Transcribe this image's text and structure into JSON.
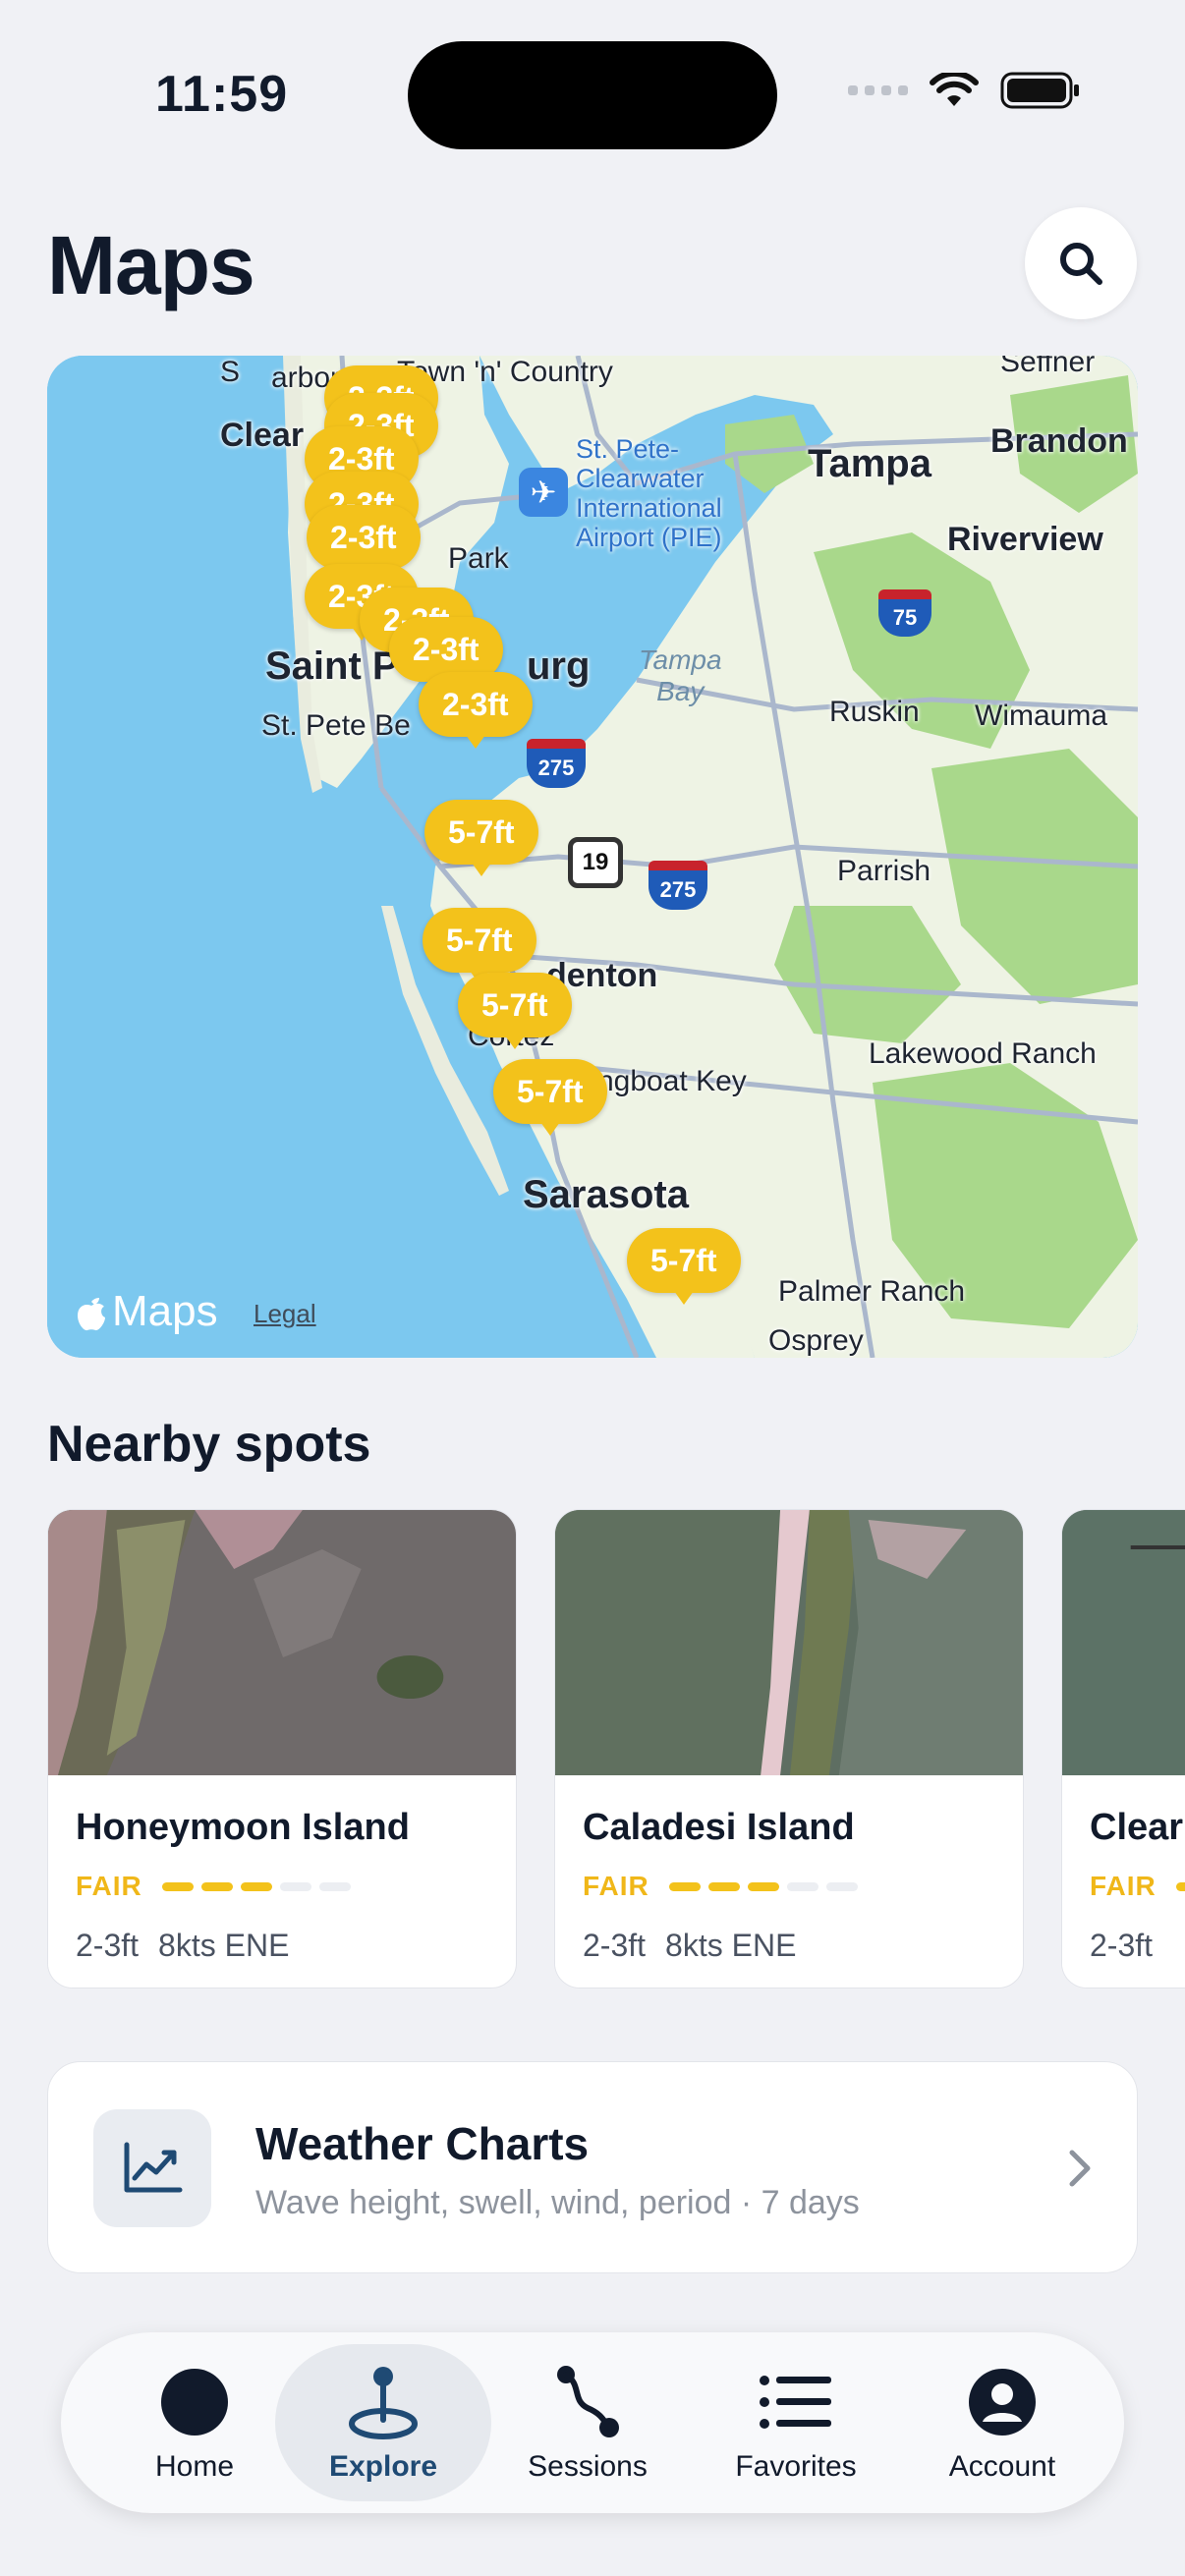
{
  "status_bar": {
    "time": "11:59"
  },
  "header": {
    "title": "Maps"
  },
  "map": {
    "labels": {
      "clearwater": "Clear",
      "harbor": "arbor",
      "s_prefix": "S",
      "town_n_country": "Town 'n' Country",
      "seffner": "Seffner",
      "tampa": "Tampa",
      "brandon": "Brandon",
      "airport": "St. Pete-\nClearwater\nInternational\nAirport (PIE)",
      "riverview": "Riverview",
      "park": "Park",
      "tampa_bay": "Tampa\nBay",
      "saint_pete": "Saint P",
      "urg": "urg",
      "st_pete_beach": "St. Pete Be",
      "ruskin": "Ruskin",
      "wimauma": "Wimauma",
      "parrish": "Parrish",
      "bradenton": "denton",
      "cortez": "Cortez",
      "longboat_key": "ngboat Key",
      "lakewood_ranch": "Lakewood Ranch",
      "sarasota": "Sarasota",
      "palmer_ranch": "Palmer Ranch",
      "osprey": "Osprey"
    },
    "shields": {
      "i275_a": "275",
      "i275_b": "275",
      "i75": "75",
      "us19": "19"
    },
    "pins": [
      "2-3ft",
      "2-3ft",
      "2-3ft",
      "2-3ft",
      "2-3ft",
      "2-3ft",
      "2-3ft",
      "2-3ft",
      "2-3ft",
      "5-7ft",
      "5-7ft",
      "5-7ft",
      "5-7ft",
      "5-7ft"
    ],
    "attribution": "Maps",
    "legal": "Legal"
  },
  "nearby": {
    "title": "Nearby spots",
    "spots": [
      {
        "name": "Honeymoon Island",
        "rating": "FAIR",
        "rating_level": 3,
        "rating_max": 5,
        "wave": "2-3ft",
        "wind": "8kts ENE"
      },
      {
        "name": "Caladesi Island",
        "rating": "FAIR",
        "rating_level": 3,
        "rating_max": 5,
        "wave": "2-3ft",
        "wind": "8kts ENE"
      },
      {
        "name": "Clear",
        "rating": "FAIR",
        "rating_level": 3,
        "rating_max": 5,
        "wave": "2-3ft",
        "wind": ""
      }
    ]
  },
  "weather_charts": {
    "title": "Weather Charts",
    "subtitle": "Wave height, swell, wind, period · 7 days"
  },
  "tabs": [
    {
      "label": "Home",
      "icon": "home-circle-icon",
      "active": false
    },
    {
      "label": "Explore",
      "icon": "map-pin-icon",
      "active": true
    },
    {
      "label": "Sessions",
      "icon": "route-icon",
      "active": false
    },
    {
      "label": "Favorites",
      "icon": "list-icon",
      "active": false
    },
    {
      "label": "Account",
      "icon": "person-icon",
      "active": false
    }
  ],
  "colors": {
    "accent": "#f3c21b",
    "active_tab_text": "#1f4a74",
    "water": "#7cc8ef",
    "land": "#eef3e4",
    "park": "#a9d88b"
  }
}
